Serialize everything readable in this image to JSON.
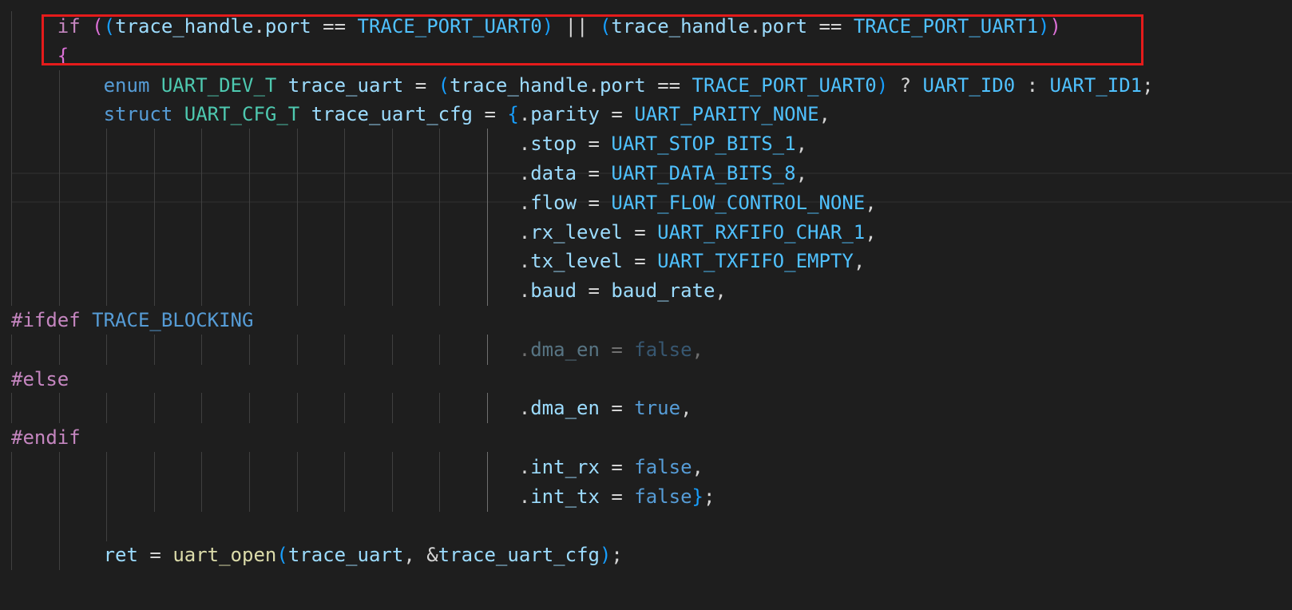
{
  "editor": {
    "language": "c",
    "theme_colors": {
      "background": "#1e1e1e",
      "keyword_control": "#c586c0",
      "keyword": "#569cd6",
      "type": "#4ec9b0",
      "variable": "#9cdcfe",
      "constant": "#4fc1ff",
      "function": "#dcdcaa",
      "highlight_box": "#e51b1b"
    },
    "lines": [
      {
        "tokens": [
          {
            "t": "    ",
            "c": "op"
          },
          {
            "t": "if",
            "c": "kw-ctrl"
          },
          {
            "t": " ",
            "c": "op"
          },
          {
            "t": "(",
            "c": "p1"
          },
          {
            "t": "(",
            "c": "p2"
          },
          {
            "t": "trace_handle",
            "c": "var"
          },
          {
            "t": ".",
            "c": "op"
          },
          {
            "t": "port",
            "c": "var"
          },
          {
            "t": " == ",
            "c": "op"
          },
          {
            "t": "TRACE_PORT_UART0",
            "c": "const"
          },
          {
            "t": ")",
            "c": "p2"
          },
          {
            "t": " || ",
            "c": "op"
          },
          {
            "t": "(",
            "c": "p2"
          },
          {
            "t": "trace_handle",
            "c": "var"
          },
          {
            "t": ".",
            "c": "op"
          },
          {
            "t": "port",
            "c": "var"
          },
          {
            "t": " == ",
            "c": "op"
          },
          {
            "t": "TRACE_PORT_UART1",
            "c": "const"
          },
          {
            "t": ")",
            "c": "p2"
          },
          {
            "t": ")",
            "c": "p1"
          }
        ]
      },
      {
        "tokens": [
          {
            "t": "    ",
            "c": "op"
          },
          {
            "t": "{",
            "c": "p1"
          }
        ]
      },
      {
        "tokens": [
          {
            "t": "        ",
            "c": "op"
          },
          {
            "t": "enum",
            "c": "kw"
          },
          {
            "t": " ",
            "c": "op"
          },
          {
            "t": "UART_DEV_T",
            "c": "type"
          },
          {
            "t": " ",
            "c": "op"
          },
          {
            "t": "trace_uart",
            "c": "var"
          },
          {
            "t": " = ",
            "c": "op"
          },
          {
            "t": "(",
            "c": "p2"
          },
          {
            "t": "trace_handle",
            "c": "var"
          },
          {
            "t": ".",
            "c": "op"
          },
          {
            "t": "port",
            "c": "var"
          },
          {
            "t": " == ",
            "c": "op"
          },
          {
            "t": "TRACE_PORT_UART0",
            "c": "const"
          },
          {
            "t": ")",
            "c": "p2"
          },
          {
            "t": " ? ",
            "c": "op"
          },
          {
            "t": "UART_ID0",
            "c": "const"
          },
          {
            "t": " : ",
            "c": "op"
          },
          {
            "t": "UART_ID1",
            "c": "const"
          },
          {
            "t": ";",
            "c": "op"
          }
        ]
      },
      {
        "tokens": [
          {
            "t": "        ",
            "c": "op"
          },
          {
            "t": "struct",
            "c": "kw"
          },
          {
            "t": " ",
            "c": "op"
          },
          {
            "t": "UART_CFG_T",
            "c": "type"
          },
          {
            "t": " ",
            "c": "op"
          },
          {
            "t": "trace_uart_cfg",
            "c": "var"
          },
          {
            "t": " = ",
            "c": "op"
          },
          {
            "t": "{",
            "c": "p2"
          },
          {
            "t": ".",
            "c": "op"
          },
          {
            "t": "parity",
            "c": "var"
          },
          {
            "t": " = ",
            "c": "op"
          },
          {
            "t": "UART_PARITY_NONE",
            "c": "const"
          },
          {
            "t": ",",
            "c": "op"
          }
        ]
      },
      {
        "tokens": [
          {
            "t": "                                            ",
            "c": "op"
          },
          {
            "t": ".",
            "c": "op"
          },
          {
            "t": "stop",
            "c": "var"
          },
          {
            "t": " = ",
            "c": "op"
          },
          {
            "t": "UART_STOP_BITS_1",
            "c": "const"
          },
          {
            "t": ",",
            "c": "op"
          }
        ]
      },
      {
        "tokens": [
          {
            "t": "                                            ",
            "c": "op"
          },
          {
            "t": ".",
            "c": "op"
          },
          {
            "t": "data",
            "c": "var"
          },
          {
            "t": " = ",
            "c": "op"
          },
          {
            "t": "UART_DATA_BITS_8",
            "c": "const"
          },
          {
            "t": ",",
            "c": "op"
          }
        ]
      },
      {
        "tokens": [
          {
            "t": "                                            ",
            "c": "op"
          },
          {
            "t": ".",
            "c": "op"
          },
          {
            "t": "flow",
            "c": "var"
          },
          {
            "t": " = ",
            "c": "op"
          },
          {
            "t": "UART_FLOW_CONTROL_NONE",
            "c": "const"
          },
          {
            "t": ",",
            "c": "op"
          }
        ]
      },
      {
        "tokens": [
          {
            "t": "                                            ",
            "c": "op"
          },
          {
            "t": ".",
            "c": "op"
          },
          {
            "t": "rx_level",
            "c": "var"
          },
          {
            "t": " = ",
            "c": "op"
          },
          {
            "t": "UART_RXFIFO_CHAR_1",
            "c": "const"
          },
          {
            "t": ",",
            "c": "op"
          }
        ]
      },
      {
        "tokens": [
          {
            "t": "                                            ",
            "c": "op"
          },
          {
            "t": ".",
            "c": "op"
          },
          {
            "t": "tx_level",
            "c": "var"
          },
          {
            "t": " = ",
            "c": "op"
          },
          {
            "t": "UART_TXFIFO_EMPTY",
            "c": "const"
          },
          {
            "t": ",",
            "c": "op"
          }
        ]
      },
      {
        "tokens": [
          {
            "t": "                                            ",
            "c": "op"
          },
          {
            "t": ".",
            "c": "op"
          },
          {
            "t": "baud",
            "c": "var"
          },
          {
            "t": " = ",
            "c": "op"
          },
          {
            "t": "baud_rate",
            "c": "var"
          },
          {
            "t": ",",
            "c": "op"
          }
        ]
      },
      {
        "tokens": [
          {
            "t": "#ifdef",
            "c": "kw-ctrl"
          },
          {
            "t": " ",
            "c": "op"
          },
          {
            "t": "TRACE_BLOCKING",
            "c": "macro"
          }
        ]
      },
      {
        "dim": true,
        "tokens": [
          {
            "t": "                                            ",
            "c": "op"
          },
          {
            "t": ".",
            "c": "op"
          },
          {
            "t": "dma_en",
            "c": "var"
          },
          {
            "t": " = ",
            "c": "op"
          },
          {
            "t": "false",
            "c": "bool"
          },
          {
            "t": ",",
            "c": "op"
          }
        ]
      },
      {
        "tokens": [
          {
            "t": "#else",
            "c": "kw-ctrl"
          }
        ]
      },
      {
        "tokens": [
          {
            "t": "                                            ",
            "c": "op"
          },
          {
            "t": ".",
            "c": "op"
          },
          {
            "t": "dma_en",
            "c": "var"
          },
          {
            "t": " = ",
            "c": "op"
          },
          {
            "t": "true",
            "c": "bool"
          },
          {
            "t": ",",
            "c": "op"
          }
        ]
      },
      {
        "tokens": [
          {
            "t": "#endif",
            "c": "kw-ctrl"
          }
        ]
      },
      {
        "tokens": [
          {
            "t": "                                            ",
            "c": "op"
          },
          {
            "t": ".",
            "c": "op"
          },
          {
            "t": "int_rx",
            "c": "var"
          },
          {
            "t": " = ",
            "c": "op"
          },
          {
            "t": "false",
            "c": "bool"
          },
          {
            "t": ",",
            "c": "op"
          }
        ]
      },
      {
        "tokens": [
          {
            "t": "                                            ",
            "c": "op"
          },
          {
            "t": ".",
            "c": "op"
          },
          {
            "t": "int_tx",
            "c": "var"
          },
          {
            "t": " = ",
            "c": "op"
          },
          {
            "t": "false",
            "c": "bool"
          },
          {
            "t": "}",
            "c": "p2"
          },
          {
            "t": ";",
            "c": "op"
          }
        ]
      },
      {
        "tokens": []
      },
      {
        "tokens": [
          {
            "t": "        ",
            "c": "op"
          },
          {
            "t": "ret",
            "c": "var"
          },
          {
            "t": " = ",
            "c": "op"
          },
          {
            "t": "uart_open",
            "c": "fn"
          },
          {
            "t": "(",
            "c": "p2"
          },
          {
            "t": "trace_uart",
            "c": "var"
          },
          {
            "t": ", &",
            "c": "op"
          },
          {
            "t": "trace_uart_cfg",
            "c": "var"
          },
          {
            "t": ")",
            "c": "p2"
          },
          {
            "t": ";",
            "c": "op"
          }
        ]
      }
    ]
  }
}
